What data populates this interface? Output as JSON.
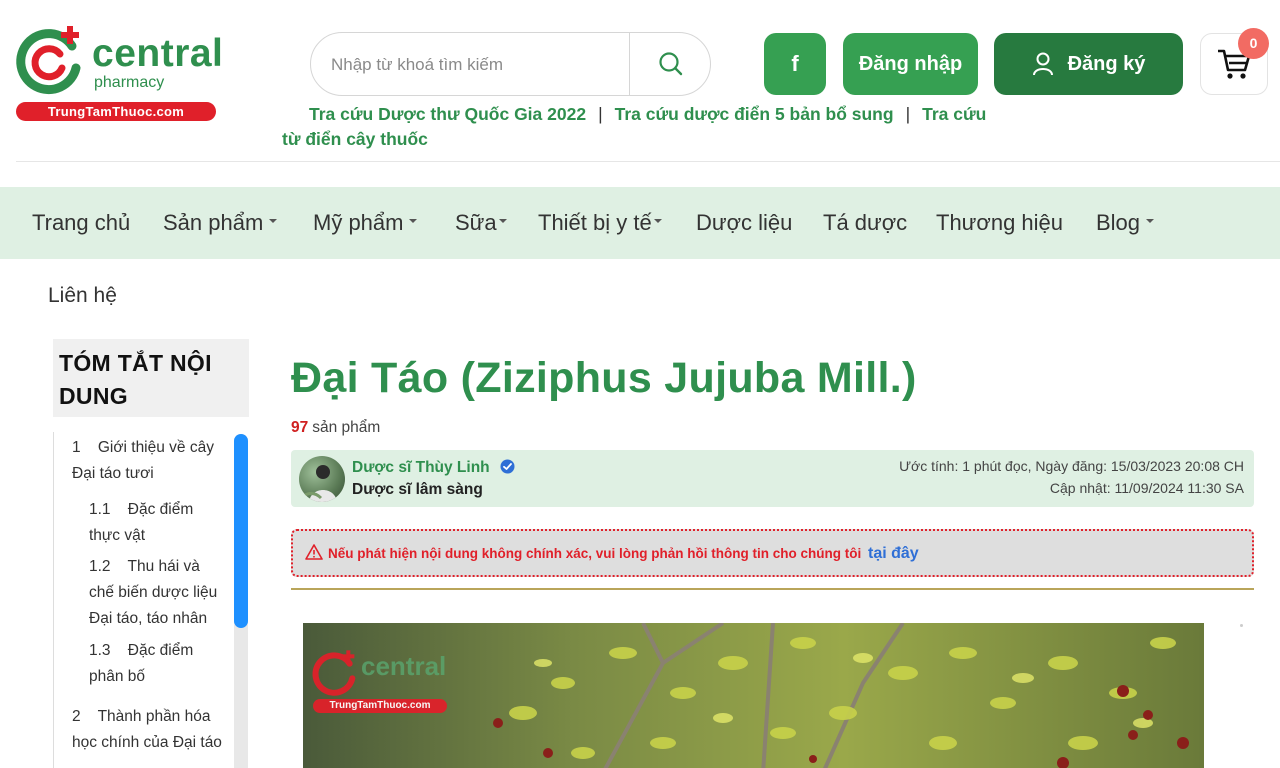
{
  "brand": {
    "name": "central",
    "subname": "pharmacy",
    "banner": "TrungTamThuoc.com"
  },
  "search": {
    "placeholder": "Nhập từ khoá tìm kiếm"
  },
  "header": {
    "facebook_label": "f",
    "login_label": "Đăng nhập",
    "signup_label": "Đăng ký",
    "cart_count": "0"
  },
  "quick_links": [
    "Tra cứu Dược thư Quốc Gia 2022",
    "Tra cứu dược điển 5 bản bổ sung",
    "Tra cứu từ điển cây thuốc"
  ],
  "quick_links_separator": "|",
  "nav": {
    "items": [
      {
        "label": "Trang chủ",
        "dropdown": false
      },
      {
        "label": "Sản phẩm",
        "dropdown": true
      },
      {
        "label": "Mỹ phẩm",
        "dropdown": true
      },
      {
        "label": "Sữa",
        "dropdown": true
      },
      {
        "label": "Thiết bị y tế",
        "dropdown": true
      },
      {
        "label": "Dược liệu",
        "dropdown": false
      },
      {
        "label": "Tá dược",
        "dropdown": false
      },
      {
        "label": "Thương hiệu",
        "dropdown": false
      },
      {
        "label": "Blog",
        "dropdown": true
      }
    ],
    "contact": "Liên hệ"
  },
  "toc": {
    "title": "TÓM TẮT NỘI DUNG",
    "items": [
      {
        "line1": "1    Giới thiệu về cây",
        "line2": "Đại táo tươi"
      },
      {
        "line1": "1.1    Đặc điểm",
        "line2": "thực vật"
      },
      {
        "line1": "1.2    Thu hái và",
        "line2": "chế biến dược liệu",
        "line3": "Đại táo, táo nhân"
      },
      {
        "line1": "1.3    Đặc điểm",
        "line2": "phân bố"
      },
      {
        "line1": "2    Thành phần hóa",
        "line2": "học chính của Đại táo"
      }
    ]
  },
  "article": {
    "title": "Đại Táo (Ziziphus Jujuba Mill.)",
    "product_count": "97",
    "product_label": "sản phẩm",
    "author_name": "Dược sĩ Thùy Linh",
    "author_role": "Dược sĩ lâm sàng",
    "meta_line1": "Ước tính: 1 phút đọc, Ngày đăng: 15/03/2023 20:08 CH",
    "meta_line2": "Cập nhật: 11/09/2024 11:30 SA",
    "alert_text": "Nếu phát hiện nội dung không chính xác, vui lòng phản hồi thông tin cho chúng tôi",
    "alert_link": "tại đây",
    "image_watermark_word": "central",
    "image_watermark_banner": "TrungTamThuoc.com"
  },
  "colors": {
    "brand_green": "#2f8f4e",
    "button_green": "#36a052",
    "button_dark_green": "#277a3f",
    "nav_bg": "#dff0e3",
    "alert_red": "#e0202a",
    "badge": "#f26b63",
    "link_blue": "#2f6fd6"
  }
}
